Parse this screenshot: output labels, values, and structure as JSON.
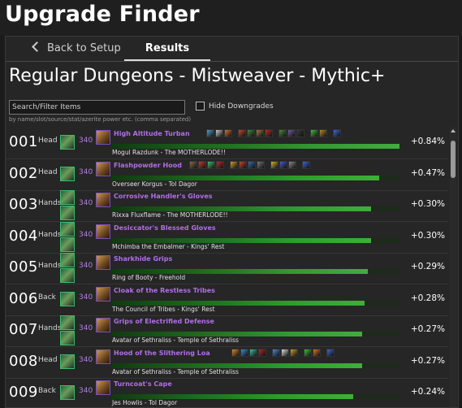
{
  "app": {
    "title": "Upgrade Finder"
  },
  "tabs": {
    "back_label": "Back to Setup",
    "results_label": "Results"
  },
  "heading": "Regular Dungeons - Mistweaver - Mythic+",
  "search": {
    "placeholder": "Search/Filter Items",
    "value": "",
    "hint": "by name/slot/source/stat/azerite power etc. (comma separated)"
  },
  "hide_downgrades": {
    "label": "Hide Downgrades",
    "checked": false
  },
  "results": [
    {
      "rank": "001",
      "slot": "Head",
      "ilvl": "340",
      "name": "High Altitude Turban",
      "source": "Mogul Razdunk - The MOTHERLODE!!",
      "pct": "+0.84%",
      "fill": 1.0,
      "slot_icon": "head-armor-icon",
      "item_icon": "turban-icon",
      "traits": [
        [
          "#4aa3d8",
          "#c9c9c9",
          "#d8732a"
        ],
        [
          "#c24a2a",
          "#3f8a3a",
          "#a07a3a",
          "#c02a2a"
        ],
        [
          "#4a8a3a",
          "#7a5aa0",
          "#3a3a3a"
        ],
        [
          "#3fbf3f",
          "#b8862a"
        ],
        [
          "#3a6ad8"
        ]
      ]
    },
    {
      "rank": "002",
      "slot": "Head",
      "ilvl": "340",
      "name": "Flashpowder Hood",
      "source": "Overseer Korgus - Tol Dagor",
      "pct": "+0.47%",
      "fill": 0.93,
      "slot_icon": "head-armor-icon",
      "item_icon": "hood-icon",
      "traits": [
        [
          "#8a6a4a",
          "#c93a2a",
          "#3fbf6a",
          "#c02a2a"
        ],
        [
          "#d89a2a",
          "#c24a2a",
          "#3a6aa8",
          "#7a7a7a"
        ],
        [
          "#d8b02a",
          "#4a5ac8",
          "#8a8a8a"
        ],
        [
          "#3a6ad8"
        ]
      ]
    },
    {
      "rank": "003",
      "slot": "Hands",
      "ilvl": "340",
      "name": "Corrosive Handler's Gloves",
      "source": "Rixxa Fluxflame - The MOTHERLODE!!",
      "pct": "+0.30%",
      "fill": 0.9,
      "slot_icon": "hands-armor-icon",
      "item_icon": "gloves-icon",
      "traits": []
    },
    {
      "rank": "004",
      "slot": "Hands",
      "ilvl": "340",
      "name": "Desiccator's Blessed Gloves",
      "source": "Mchimba the Embalmer - Kings' Rest",
      "pct": "+0.30%",
      "fill": 0.9,
      "slot_icon": "hands-armor-icon",
      "item_icon": "gloves-icon",
      "traits": []
    },
    {
      "rank": "005",
      "slot": "Hands",
      "ilvl": "340",
      "name": "Sharkhide Grips",
      "source": "Ring of Booty - Freehold",
      "pct": "+0.29%",
      "fill": 0.89,
      "slot_icon": "hands-armor-icon",
      "item_icon": "grips-icon",
      "traits": []
    },
    {
      "rank": "006",
      "slot": "Back",
      "ilvl": "340",
      "name": "Cloak of the Restless Tribes",
      "source": "The Council of Tribes - Kings' Rest",
      "pct": "+0.28%",
      "fill": 0.88,
      "slot_icon": "back-armor-icon",
      "item_icon": "cloak-icon",
      "traits": []
    },
    {
      "rank": "007",
      "slot": "Hands",
      "ilvl": "340",
      "name": "Grips of Electrified Defense",
      "source": "Avatar of Sethraliss - Temple of Sethraliss",
      "pct": "+0.27%",
      "fill": 0.87,
      "slot_icon": "hands-armor-icon",
      "item_icon": "grips-icon",
      "traits": []
    },
    {
      "rank": "008",
      "slot": "Head",
      "ilvl": "340",
      "name": "Hood of the Slithering Loa",
      "source": "Avatar of Sethraliss - Temple of Sethraliss",
      "pct": "+0.27%",
      "fill": 0.87,
      "slot_icon": "head-armor-icon",
      "item_icon": "hood-icon",
      "traits": [
        [
          "#d88a2a",
          "#3a8ad8",
          "#3fbf9a",
          "#b02a2a"
        ],
        [
          "#4a8ad8",
          "#e0e0e0",
          "#c9a02a"
        ],
        [
          "#3fbf3f",
          "#d8732a"
        ],
        [
          "#3a6ad8"
        ]
      ]
    },
    {
      "rank": "009",
      "slot": "Back",
      "ilvl": "340",
      "name": "Turncoat's Cape",
      "source": "Jes Howlis - Tol Dagor",
      "pct": "+0.24%",
      "fill": 0.84,
      "slot_icon": "back-armor-icon",
      "item_icon": "cape-icon",
      "traits": []
    }
  ],
  "colors": {
    "upgrade_bar": "#3fae3a",
    "item_name": "#b06ee8",
    "item_level": "#b07fe0"
  }
}
